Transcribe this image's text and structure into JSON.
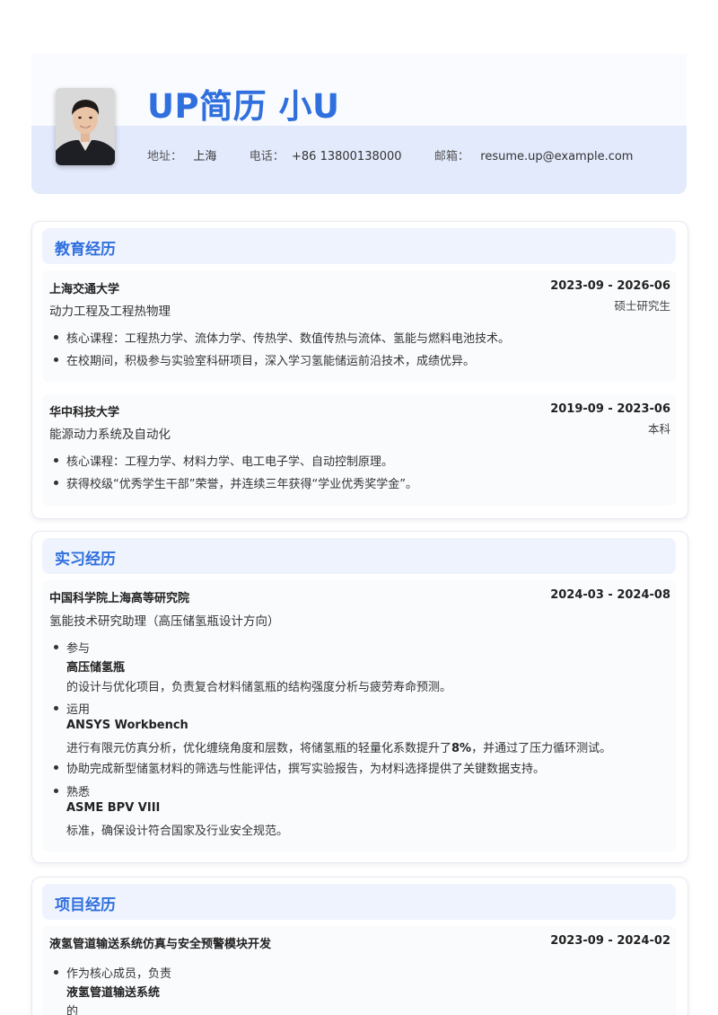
{
  "header": {
    "name": "UP简历 小U",
    "address_label": "地址：",
    "address": "上海",
    "phone_label": "电话：",
    "phone": "+86 13800138000",
    "email_label": "邮箱：",
    "email": "resume.up@example.com"
  },
  "education": {
    "title": "教育经历",
    "items": [
      {
        "school": "上海交通大学",
        "date": "2023-09 - 2026-06",
        "major": "动力工程及工程热物理",
        "degree": "硕士研究生",
        "bullets": [
          "核心课程：工程热力学、流体力学、传热学、数值传热与流体、氢能与燃料电池技术。",
          "在校期间，积极参与实验室科研项目，深入学习氢能储运前沿技术，成绩优异。"
        ]
      },
      {
        "school": "华中科技大学",
        "date": "2019-09 - 2023-06",
        "major": "能源动力系统及自动化",
        "degree": "本科",
        "bullets": [
          "核心课程：工程力学、材料力学、电工电子学、自动控制原理。",
          "获得校级“优秀学生干部”荣誉，并连续三年获得“学业优秀奖学金”。"
        ]
      }
    ]
  },
  "internship": {
    "title": "实习经历",
    "org": "中国科学院上海高等研究院",
    "date": "2024-03 - 2024-08",
    "role": "氢能技术研究助理（高压储氢瓶设计方向）",
    "b1_a": "参与",
    "b1_b": "高压储氢瓶",
    "b1_c": "的设计与优化项目，负责复合材料储氢瓶的结构强度分析与疲劳寿命预测。",
    "b2_a": "运用",
    "b2_b": "ANSYS Workbench",
    "b2_c1": "进行有限元仿真分析，优化缠绕角度和层数，将储氢瓶的轻量化系数提升了",
    "b2_c2": "8%",
    "b2_c3": "，并通过了压力循环测试。",
    "b3": "协助完成新型储氢材料的筛选与性能评估，撰写实验报告，为材料选择提供了关键数据支持。",
    "b4_a": "熟悉",
    "b4_b": "ASME BPV VIII",
    "b4_c": "标准，确保设计符合国家及行业安全规范。"
  },
  "project": {
    "title": "项目经历",
    "name": "液氢管道输送系统仿真与安全预警模块开发",
    "date": "2023-09 - 2024-02",
    "b1_a": "作为核心成员，负责",
    "b1_b": "液氢管道输送系统",
    "b1_c": "的"
  }
}
